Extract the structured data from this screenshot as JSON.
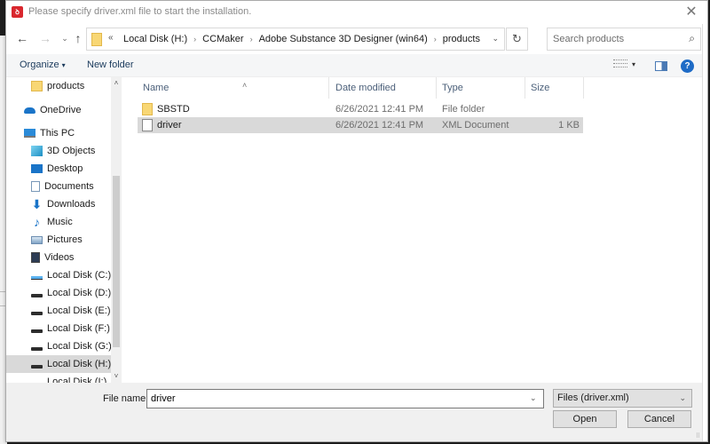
{
  "window": {
    "title": "Please specify driver.xml file to start the installation.",
    "app_icon_glyph": "ꝺ",
    "close_glyph": "✕"
  },
  "navigation": {
    "back_glyph": "←",
    "forward_glyph": "→",
    "recent_glyph": "⌄",
    "up_glyph": "↑",
    "overflow_glyph": "«",
    "breadcrumbs": [
      "Local Disk (H:)",
      "CCMaker",
      "Adobe Substance 3D Designer (win64)",
      "products"
    ],
    "separator_glyph": "›",
    "dropdown_glyph": "⌄",
    "refresh_glyph": "↻",
    "search_placeholder": "Search products",
    "search_glyph": "⌕"
  },
  "toolbar": {
    "organize_label": "Organize",
    "organize_caret": "▾",
    "new_folder_label": "New folder",
    "view_caret": "▾",
    "help_glyph": "?"
  },
  "nav_pane": {
    "items": [
      {
        "label": "products",
        "icon": "folder-icon"
      },
      {
        "label": "OneDrive",
        "icon": "onedrive-icon"
      },
      {
        "label": "This PC",
        "icon": "pc-icon"
      },
      {
        "label": "3D Objects",
        "icon": "3d-objects-icon"
      },
      {
        "label": "Desktop",
        "icon": "desktop-icon"
      },
      {
        "label": "Documents",
        "icon": "documents-icon"
      },
      {
        "label": "Downloads",
        "icon": "downloads-icon"
      },
      {
        "label": "Music",
        "icon": "music-icon"
      },
      {
        "label": "Pictures",
        "icon": "pictures-icon"
      },
      {
        "label": "Videos",
        "icon": "videos-icon"
      },
      {
        "label": "Local Disk (C:)",
        "icon": "system-disk-icon"
      },
      {
        "label": "Local Disk (D:)",
        "icon": "disk-icon"
      },
      {
        "label": "Local Disk (E:)",
        "icon": "disk-icon"
      },
      {
        "label": "Local Disk (F:)",
        "icon": "disk-icon"
      },
      {
        "label": "Local Disk (G:)",
        "icon": "disk-icon"
      },
      {
        "label": "Local Disk (H:)",
        "icon": "disk-icon",
        "selected": true
      },
      {
        "label": "Local Disk (I:)",
        "icon": "disk-icon"
      }
    ],
    "downloads_glyph": "⬇",
    "music_glyph": "♪",
    "scroll_up_glyph": "˄",
    "scroll_down_glyph": "˅"
  },
  "file_list": {
    "sort_glyph": "˄",
    "columns": [
      "Name",
      "Date modified",
      "Type",
      "Size"
    ],
    "rows": [
      {
        "name": "SBSTD",
        "date": "6/26/2021 12:41 PM",
        "type": "File folder",
        "size": "",
        "icon": "folder-icon"
      },
      {
        "name": "driver",
        "date": "6/26/2021 12:41 PM",
        "type": "XML Document",
        "size": "1 KB",
        "icon": "document-icon",
        "selected": true
      }
    ]
  },
  "bottom": {
    "file_name_label": "File name:",
    "file_name_value": "driver",
    "file_name_dropdown_glyph": "⌄",
    "filter_value": "Files (driver.xml)",
    "filter_dropdown_glyph": "⌄",
    "open_label": "Open",
    "cancel_label": "Cancel",
    "grip_glyph": "⠿"
  }
}
